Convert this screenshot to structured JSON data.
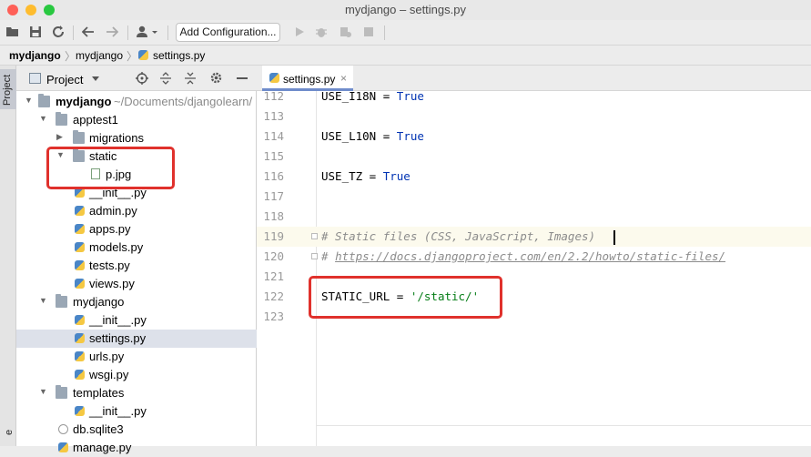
{
  "window": {
    "title": "mydjango – settings.py",
    "colors": {
      "close": "#fe5f57",
      "minimize": "#febc2e",
      "zoom": "#28c840"
    }
  },
  "toolbar": {
    "add_configuration_label": "Add Configuration..."
  },
  "navbar": {
    "crumbs": [
      "mydjango",
      "mydjango",
      "settings.py"
    ]
  },
  "sidebar_strip": {
    "project_label": "Project",
    "bottom_label": "e"
  },
  "project_panel": {
    "title": "Project",
    "tree": [
      {
        "label": "mydjango",
        "suffix": " ~/Documents/djangolearn/",
        "type": "folder",
        "expanded": true
      },
      {
        "label": "apptest1",
        "type": "folder",
        "expanded": true
      },
      {
        "label": "migrations",
        "type": "folder",
        "expanded": false
      },
      {
        "label": "static",
        "type": "folder",
        "expanded": true
      },
      {
        "label": "p.jpg",
        "type": "image"
      },
      {
        "label": "__init__.py",
        "type": "python"
      },
      {
        "label": "admin.py",
        "type": "python"
      },
      {
        "label": "apps.py",
        "type": "python"
      },
      {
        "label": "models.py",
        "type": "python"
      },
      {
        "label": "tests.py",
        "type": "python"
      },
      {
        "label": "views.py",
        "type": "python"
      },
      {
        "label": "mydjango",
        "type": "folder",
        "expanded": true
      },
      {
        "label": "__init__.py",
        "type": "python"
      },
      {
        "label": "settings.py",
        "type": "python",
        "selected": true
      },
      {
        "label": "urls.py",
        "type": "python"
      },
      {
        "label": "wsgi.py",
        "type": "python"
      },
      {
        "label": "templates",
        "type": "folder",
        "expanded": true
      },
      {
        "label": "__init__.py",
        "type": "python"
      },
      {
        "label": "db.sqlite3",
        "type": "database"
      },
      {
        "label": "manage.py",
        "type": "python"
      }
    ]
  },
  "editor": {
    "tab_label": "settings.py",
    "tab_close": "×",
    "lines": [
      {
        "num": "112",
        "name": "USE_I18N",
        "op": " = ",
        "value": "True",
        "kind": "kw"
      },
      {
        "num": "113"
      },
      {
        "num": "114",
        "name": "USE_L10N",
        "op": " = ",
        "value": "True",
        "kind": "kw"
      },
      {
        "num": "115"
      },
      {
        "num": "116",
        "name": "USE_TZ",
        "op": " = ",
        "value": "True",
        "kind": "kw"
      },
      {
        "num": "117"
      },
      {
        "num": "118"
      },
      {
        "num": "119",
        "comment": "# Static files (CSS, JavaScript, Images)"
      },
      {
        "num": "120",
        "comment_prefix": "# ",
        "comment_link": "https://docs.djangoproject.com/en/2.2/howto/static-files/"
      },
      {
        "num": "121"
      },
      {
        "num": "122",
        "name": "STATIC_URL",
        "op": " = ",
        "value": "'/static/'",
        "kind": "str"
      },
      {
        "num": "123"
      }
    ]
  },
  "highlight_color": "#e0312c"
}
